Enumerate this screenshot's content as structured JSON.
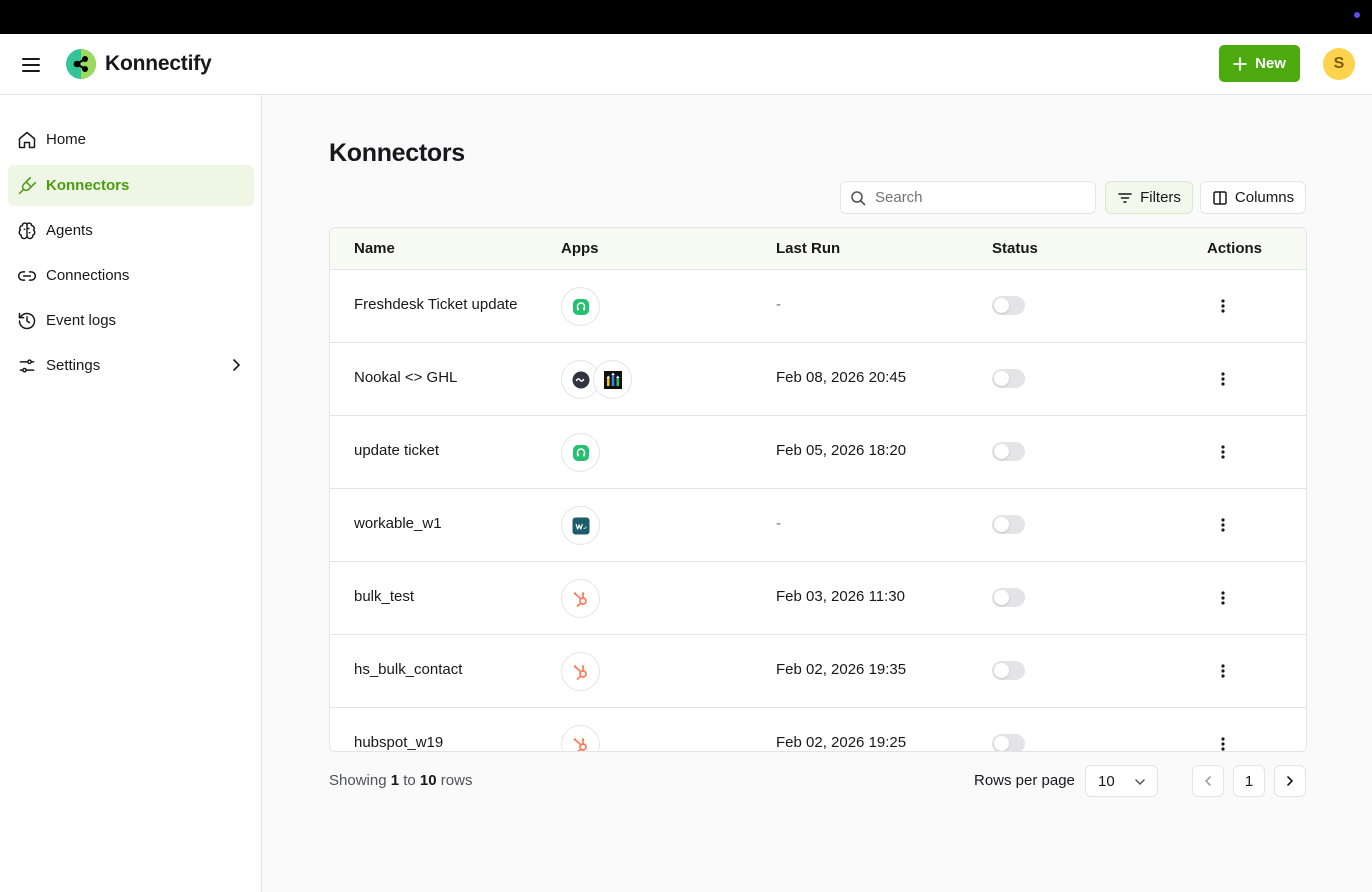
{
  "app": {
    "brand": "Konnectify",
    "new_label": "New",
    "avatar_initial": "S",
    "accent_color": "#4caa0f"
  },
  "sidebar": {
    "items": [
      {
        "label": "Home",
        "icon": "home-icon"
      },
      {
        "label": "Konnectors",
        "icon": "plug-icon",
        "active": true
      },
      {
        "label": "Agents",
        "icon": "brain-icon"
      },
      {
        "label": "Connections",
        "icon": "link-icon"
      },
      {
        "label": "Event logs",
        "icon": "history-icon"
      },
      {
        "label": "Settings",
        "icon": "sliders-icon"
      }
    ]
  },
  "main": {
    "title": "Konnectors",
    "search_placeholder": "Search",
    "filters_label": "Filters",
    "columns_label": "Columns"
  },
  "table": {
    "headers": {
      "name": "Name",
      "apps": "Apps",
      "last_run": "Last Run",
      "status": "Status",
      "actions": "Actions"
    },
    "rows": [
      {
        "name": "Freshdesk Ticket update",
        "apps": [
          "freshdesk-icon"
        ],
        "last_run": "-",
        "enabled": false
      },
      {
        "name": "Nookal <> GHL",
        "apps": [
          "nookal-icon",
          "gohighlevel-icon"
        ],
        "last_run": "Feb 08, 2026 20:45",
        "enabled": false
      },
      {
        "name": "update ticket",
        "apps": [
          "freshdesk-icon"
        ],
        "last_run": "Feb 05, 2026 18:20",
        "enabled": false
      },
      {
        "name": "workable_w1",
        "apps": [
          "workable-icon"
        ],
        "last_run": "-",
        "enabled": false
      },
      {
        "name": "bulk_test",
        "apps": [
          "hubspot-icon"
        ],
        "last_run": "Feb 03, 2026 11:30",
        "enabled": false
      },
      {
        "name": "hs_bulk_contact",
        "apps": [
          "hubspot-icon"
        ],
        "last_run": "Feb 02, 2026 19:35",
        "enabled": false
      },
      {
        "name": "hubspot_w19",
        "apps": [
          "hubspot-icon"
        ],
        "last_run": "Feb 02, 2026 19:25",
        "enabled": false
      }
    ]
  },
  "footer": {
    "showing_prefix": "Showing",
    "showing_from": "1",
    "showing_to_word": "to",
    "showing_to": "10",
    "showing_suffix": "rows",
    "rows_per_page_label": "Rows per page",
    "rows_per_page_value": "10",
    "current_page": "1"
  }
}
